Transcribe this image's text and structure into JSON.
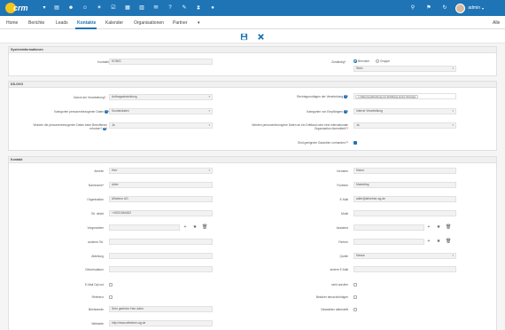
{
  "brand": {
    "logo_text": "crm",
    "logo_color": "#f5c518",
    "topbar_color": "#1e74b5"
  },
  "topbar": {
    "icons": [
      "menu-icon",
      "documents-icon",
      "contacts-icon",
      "users-icon",
      "handshake-icon",
      "tasks-icon",
      "calendar-icon",
      "chart-icon",
      "email-icon",
      "help-icon",
      "settings-icon",
      "hourglass-icon",
      "chat-icon"
    ],
    "right_icons": [
      "search-icon",
      "flag-icon",
      "history-icon",
      "notification-icon"
    ],
    "user_name": "admin"
  },
  "nav": {
    "items": [
      "Home",
      "Berichte",
      "Leads",
      "Kontakte",
      "Kalender",
      "Organisationen",
      "Partner"
    ],
    "more": "▾",
    "all": "Alle",
    "active": "Kontakte"
  },
  "sections": {
    "system": {
      "title": "Systeminformationen",
      "kontakt_nr_label": "Kontaktnr.",
      "kontakt_nr_value": "KON01",
      "zustaendig_label": "Zuständig",
      "zustaendig_req": "*",
      "radio_benutzer": "Benutzer",
      "radio_gruppe": "Gruppe",
      "zustaendig_value": "Stein"
    },
    "dsgvo": {
      "title": "DS-GVO",
      "zweck_label": "Zweck der Verarbeitung",
      "zweck_req": "*",
      "zweck_value": "Auftragsabwicklung",
      "rechts_label": "Rechtsgrundlagen der Verarbeitung",
      "rechts_req": "*",
      "rechts_chip": "Datenverarbeitung zur Erfüllung eines Vertrags",
      "kat_daten_label": "Kategorien personenbezogener Daten",
      "kat_daten_req": "*",
      "kat_daten_value": "Kundendaten",
      "kat_empf_label": "Kategorien von Empfängern",
      "kat_empf_req": "*",
      "kat_empf_value": "Interne Verarbeitung",
      "erhoben_label": "Wurden die personenbezogenen Daten beim Betroffenen erhoben?",
      "erhoben_req": "*",
      "erhoben_value": "Ja",
      "drittland_label": "Werden personenbezogene Daten an ein Drittland oder eine internationale Organisation übermittelt?",
      "drittland_req": "*",
      "drittland_value": "Ja",
      "garantien_label": "Sind geeignete Garantien vorhanden?",
      "garantien_req": "*",
      "garantien_checked": true
    },
    "kontakt": {
      "title": "Kontakt",
      "anrede_label": "Anrede",
      "anrede_value": "Herr",
      "vorname_label": "Vorname",
      "vorname_value": "Marco",
      "nachname_label": "Nachname",
      "nachname_req": "*",
      "nachname_value": "Adler",
      "funktion_label": "Funktion",
      "funktion_value": "Marketing",
      "org_label": "Organisation",
      "org_value": "Alfnetner AG",
      "email_label": "E-Mail",
      "email_value": "adler@alfnetner-ag.de",
      "tel_label": "Tel. direkt",
      "tel_value": "+49231564632",
      "mobil_label": "Mobil",
      "mobil_value": "",
      "vorgesetzter_label": "Vorgesetzter",
      "vorgesetzter_value": "",
      "assistent_label": "Assistent",
      "assistent_value": "",
      "andere_tel_label": "anderes Tel.",
      "andere_tel_value": "",
      "partner_label": "Partner",
      "partner_value": "",
      "abteilung_label": "Abteilung",
      "abteilung_value": "",
      "quelle_label": "Quelle",
      "quelle_value": "Messe",
      "geburtsdatum_label": "Geburtsdatum",
      "geburtsdatum_value": "",
      "andere_email_label": "andere E-Mail",
      "andere_email_value": "",
      "email_optout_label": "E-Mail Opt out",
      "nicht_anrufen_label": "nicht anrufen",
      "referenz_label": "Referenz",
      "besitzer_label": "Besitzer benachrichtigen",
      "briefanrede_label": "Briefanrede",
      "briefanrede_value": "Sehr geehrter Herr Adler",
      "newsletter_label": "Newsletter abbestellt",
      "website_label": "Webseite",
      "website_value": "http://www.alfnetner-ag.de"
    }
  }
}
